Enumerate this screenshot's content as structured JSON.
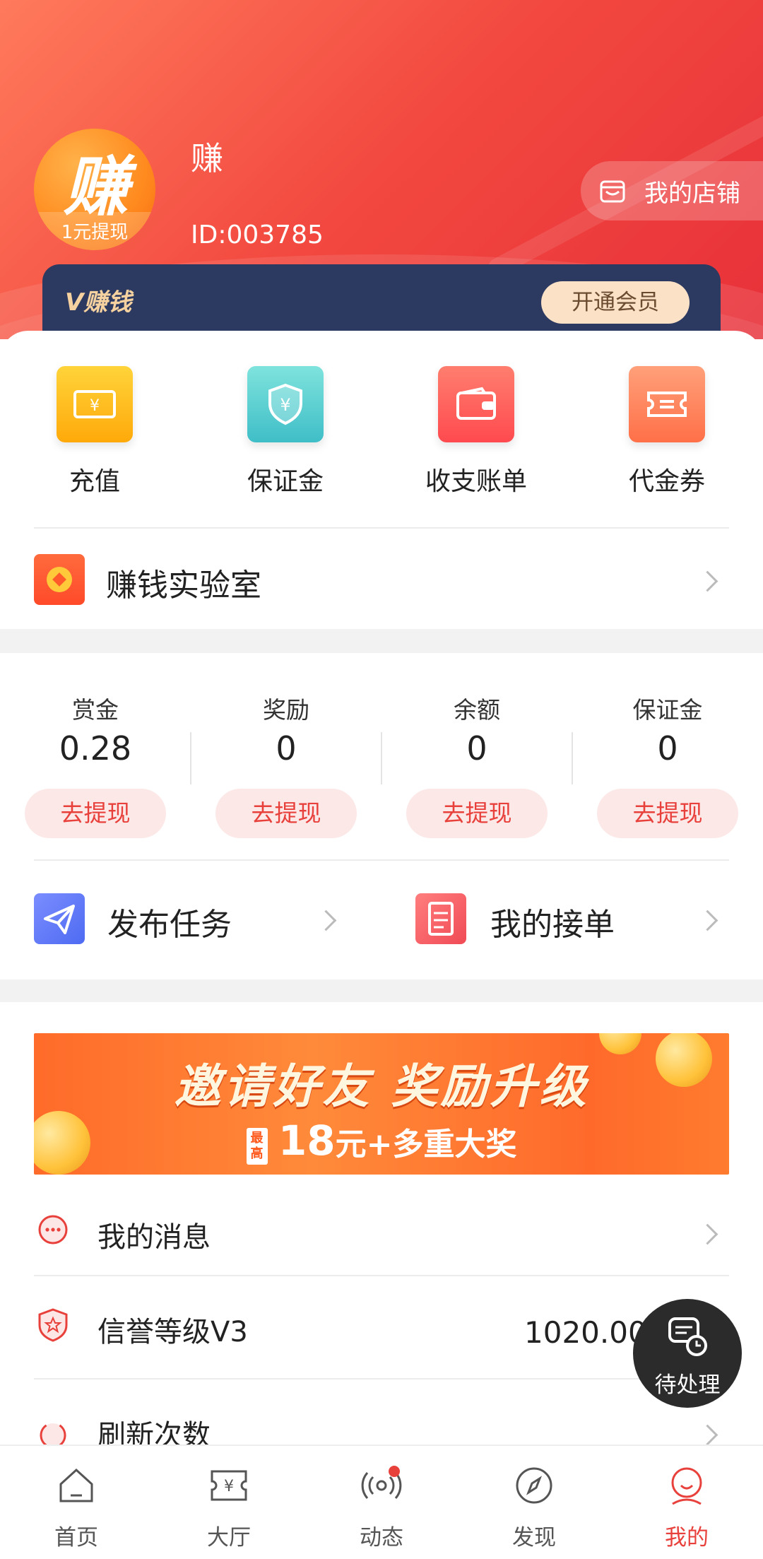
{
  "profile": {
    "avatar_char": "赚",
    "avatar_caption": "1元提现",
    "name": "赚",
    "id_text": "ID:003785",
    "shop_button": "我的店铺"
  },
  "vip": {
    "logo": "V赚钱",
    "button": "开通会员"
  },
  "quick_actions": [
    {
      "label": "充值",
      "icon": "ticket-yen-icon",
      "color": "#ffbe1a"
    },
    {
      "label": "保证金",
      "icon": "shield-yen-icon",
      "color": "#5fd0d0"
    },
    {
      "label": "收支账单",
      "icon": "wallet-icon",
      "color": "#ff5a5a"
    },
    {
      "label": "代金券",
      "icon": "coupon-icon",
      "color": "#ff8a5c"
    }
  ],
  "lab": {
    "label": "赚钱实验室"
  },
  "balances": [
    {
      "label": "赏金",
      "value": "0.28",
      "button": "去提现"
    },
    {
      "label": "奖励",
      "value": "0",
      "button": "去提现"
    },
    {
      "label": "余额",
      "value": "0",
      "button": "去提现"
    },
    {
      "label": "保证金",
      "value": "0",
      "button": "去提现"
    }
  ],
  "tasks": {
    "publish": "发布任务",
    "orders": "我的接单"
  },
  "banner": {
    "headline": "邀请好友  奖励升级",
    "badge": "最高",
    "amount": "18",
    "rest": "元+多重大奖"
  },
  "menu": [
    {
      "label": "我的消息",
      "value": ""
    },
    {
      "label": "信誉等级V3",
      "value": "1020.00分"
    },
    {
      "label": "刷新次数",
      "value": ""
    }
  ],
  "fab": {
    "label": "待处理"
  },
  "tabs": [
    {
      "label": "首页",
      "icon": "home-icon"
    },
    {
      "label": "大厅",
      "icon": "hall-ticket-icon"
    },
    {
      "label": "动态",
      "icon": "broadcast-icon"
    },
    {
      "label": "发现",
      "icon": "compass-icon"
    },
    {
      "label": "我的",
      "icon": "user-icon"
    }
  ],
  "colors": {
    "accent": "#e8413c",
    "header_gradient": "#f2483f",
    "vip_bar": "#2c3960"
  }
}
